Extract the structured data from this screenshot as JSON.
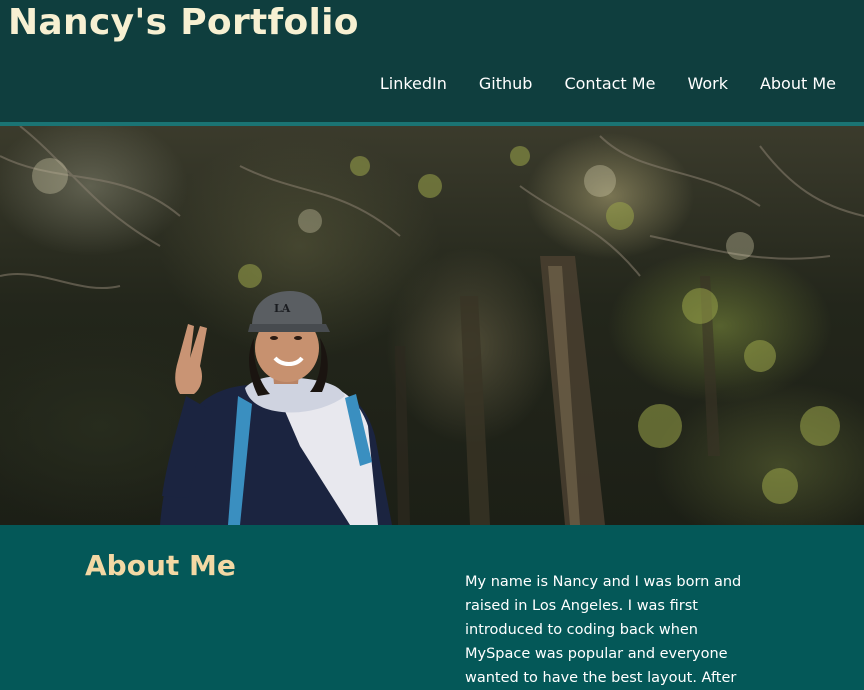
{
  "header": {
    "title": "Nancy's Portfolio",
    "nav": [
      {
        "label": "LinkedIn"
      },
      {
        "label": "Github"
      },
      {
        "label": "Contact Me"
      },
      {
        "label": "Work"
      },
      {
        "label": "About Me"
      }
    ]
  },
  "hero": {
    "image": "photo of person hiking in forest giving peace sign"
  },
  "about": {
    "heading": "About Me",
    "text": "My name is Nancy and I was born and raised in Los Angeles. I was first introduced to coding back when MySpace was popular and everyone wanted to have the best layout. After"
  },
  "colors": {
    "header_bg": "#0f3e3e",
    "body_bg": "#045858",
    "title": "#f7f0d2",
    "heading": "#f3d8a4",
    "nav_text": "#ffffff"
  }
}
